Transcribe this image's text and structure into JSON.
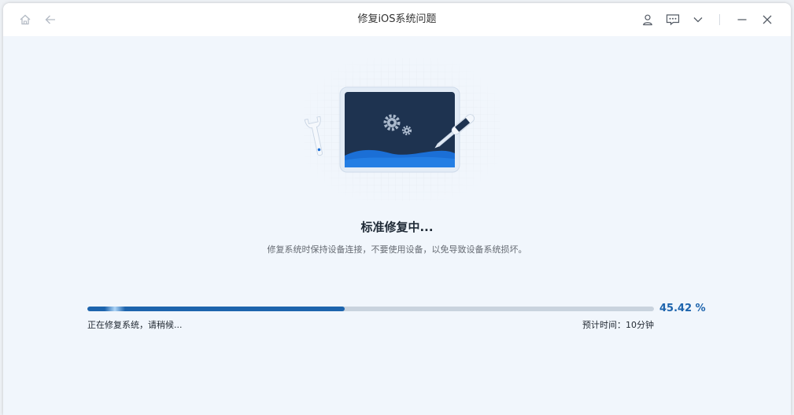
{
  "window": {
    "title": "修复iOS系统问题"
  },
  "titlebar": {
    "left_icons": [
      "home-icon",
      "back-arrow-icon"
    ],
    "right_icons": [
      "user-icon",
      "feedback-icon",
      "dropdown-icon",
      "minimize-icon",
      "close-icon"
    ]
  },
  "main": {
    "heading": "标准修复中...",
    "subtext": "修复系统时保持设备连接，不要使用设备，以免导致设备系统损坏。"
  },
  "progress": {
    "fraction": 0.4542,
    "percent_label": "45.42 %",
    "status_label": "正在修复系统，请稍候...",
    "eta_label": "预计时间：10分钟"
  },
  "colors": {
    "accent": "#1d64ad",
    "track": "#c9d3de",
    "screen": "#1e3350",
    "background": "#f1f6fc"
  }
}
